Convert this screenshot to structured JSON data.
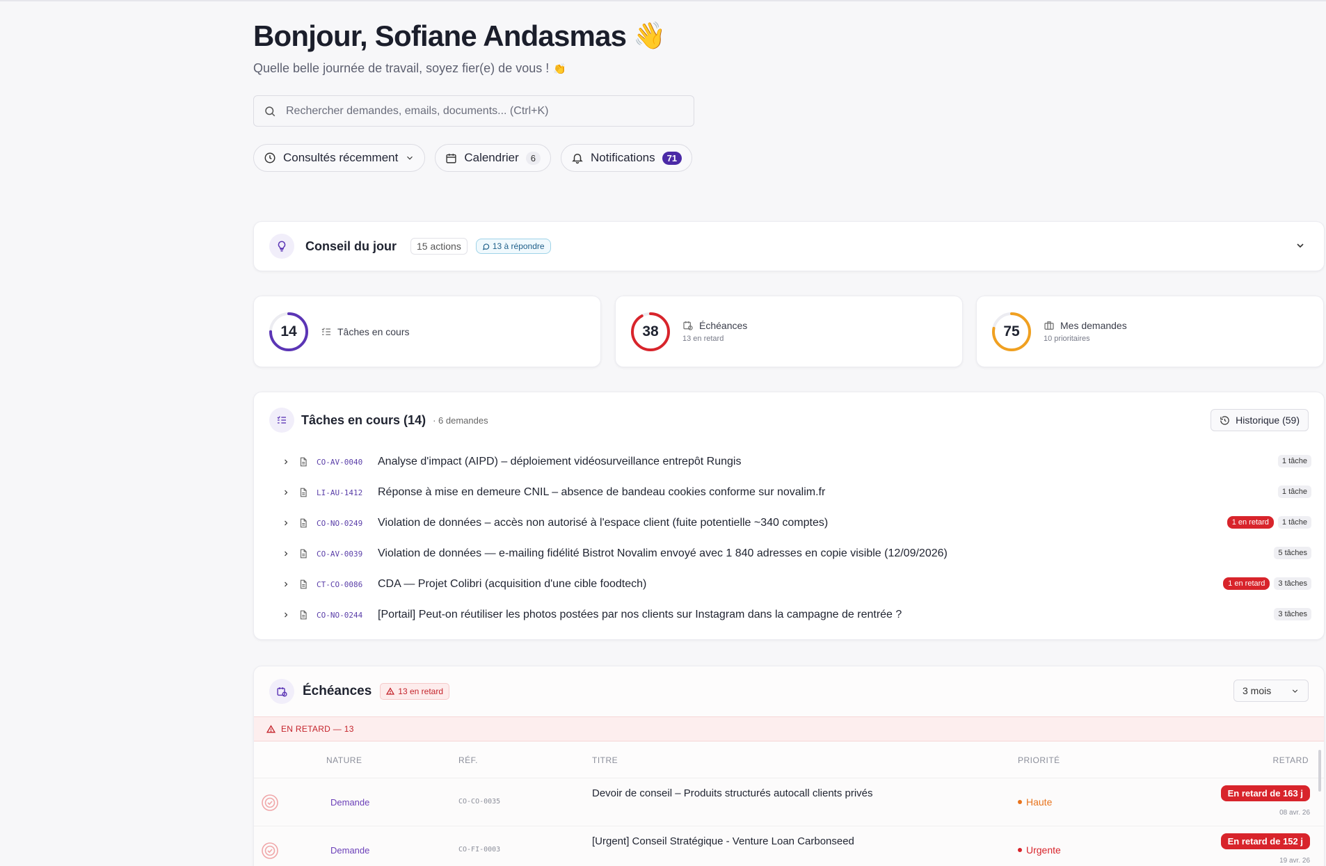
{
  "greeting": {
    "title": "Bonjour, Sofiane Andasmas",
    "wave": "👋",
    "subtitle": "Quelle belle journée de travail, soyez fier(e) de vous !",
    "clap": "👏"
  },
  "search": {
    "placeholder": "Rechercher demandes, emails, documents... (Ctrl+K)"
  },
  "chips": {
    "recent": "Consultés récemment",
    "calendar": "Calendrier",
    "calendar_count": "6",
    "notifications": "Notifications",
    "notifications_count": "71"
  },
  "conseil": {
    "title": "Conseil du jour",
    "actions": "15 actions",
    "to_answer": "13 à répondre"
  },
  "stats": [
    {
      "value": "14",
      "label": "Tâches en cours",
      "sub": "",
      "color": "#5b35b5",
      "fraction": 0.75
    },
    {
      "value": "38",
      "label": "Échéances",
      "sub": "13 en retard",
      "color": "#d8242b",
      "fraction": 0.92
    },
    {
      "value": "75",
      "label": "Mes demandes",
      "sub": "10 prioritaires",
      "color": "#f0a020",
      "fraction": 0.78
    }
  ],
  "taches": {
    "title": "Tâches en cours (14)",
    "meta": "· 6 demandes",
    "history": "Historique (59)",
    "rows": [
      {
        "ref": "CO-AV-0040",
        "title": "Analyse d'impact (AIPD) – déploiement vidéosurveillance entrepôt Rungis",
        "late": "",
        "tasks": "1 tâche"
      },
      {
        "ref": "LI-AU-1412",
        "title": "Réponse à mise en demeure CNIL – absence de bandeau cookies conforme sur novalim.fr",
        "late": "",
        "tasks": "1 tâche"
      },
      {
        "ref": "CO-NO-0249",
        "title": "Violation de données – accès non autorisé à l'espace client (fuite potentielle ~340 comptes)",
        "late": "1 en retard",
        "tasks": "1 tâche"
      },
      {
        "ref": "CO-AV-0039",
        "title": "Violation de données — e-mailing fidélité Bistrot Novalim envoyé avec 1 840 adresses en copie visible (12/09/2026)",
        "late": "",
        "tasks": "5 tâches"
      },
      {
        "ref": "CT-CO-0086",
        "title": "CDA — Projet Colibri (acquisition d'une cible foodtech)",
        "late": "1 en retard",
        "tasks": "3 tâches"
      },
      {
        "ref": "CO-NO-0244",
        "title": "[Portail] Peut-on réutiliser les photos postées par nos clients sur Instagram dans la campagne de rentrée ?",
        "late": "",
        "tasks": "3 tâches"
      }
    ]
  },
  "echeances": {
    "title": "Échéances",
    "late_badge": "13 en retard",
    "period": "3 mois",
    "late_band": "EN RETARD — 13",
    "headers": {
      "nature": "NATURE",
      "ref": "RÉF.",
      "title": "TITRE",
      "priority": "PRIORITÉ",
      "delay": "RETARD"
    },
    "rows": [
      {
        "nature": "Demande",
        "ref": "CO-CO-0035",
        "title": "Devoir de conseil – Produits structurés autocall clients privés",
        "priority": "Haute",
        "priority_color": "#e8731c",
        "delay": "En retard de 163 j",
        "date": "08 avr. 26"
      },
      {
        "nature": "Demande",
        "ref": "CO-FI-0003",
        "title": "[Urgent] Conseil Stratégique - Venture Loan Carbonseed",
        "priority": "Urgente",
        "priority_color": "#d8242b",
        "delay": "En retard de 152 j",
        "date": "19 avr. 26"
      }
    ]
  }
}
